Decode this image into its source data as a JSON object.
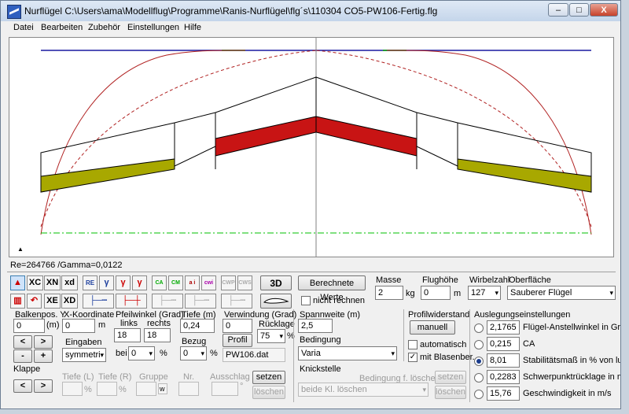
{
  "window": {
    "title": "Nurflügel   C:\\Users\\ama\\Modellflug\\Programme\\Ranis-Nurflügel\\flg´s\\110304 CO5-PW106-Fertig.flg",
    "minimize": "–",
    "maximize": "□",
    "close": "X"
  },
  "menu": [
    "Datei",
    "Bearbeiten",
    "Zubehör",
    "Einstellungen",
    "Hilfe"
  ],
  "colors": {
    "centerline": "#1a1aa0",
    "lift_curve": "#b02020",
    "tip_span": "#b8b800",
    "center_span": "#c81414",
    "ground": "#00c000"
  },
  "status": "Re=264766 /Gamma=0,0122",
  "toolbar": {
    "row1": [
      "RE",
      "γ",
      "γ",
      "γ",
      "CA",
      "CM",
      "a i",
      "cwi",
      "CWP",
      "CWS"
    ],
    "row1_text": [
      "XC",
      "XN",
      "xd"
    ],
    "row2_text": [
      "XE",
      "XD"
    ],
    "btn_3d": "3D",
    "btn_calc": "Berechnete Werte",
    "nicht_rechnen": "nicht rechnen"
  },
  "balkenpos": {
    "label": "Balkenpos. Y",
    "value": "0",
    "unit": "(m)"
  },
  "xkoord": {
    "label": "X-Koordinate",
    "value": "0",
    "unit": "m"
  },
  "eingaben": {
    "label": "Eingaben",
    "value": "symmetri"
  },
  "pfeil": {
    "label": "Pfeilwinkel (Grad)",
    "links": "links",
    "rechts": "rechts",
    "left_value": "18",
    "right_value": "18",
    "bei_label": "bei",
    "bei_value": "0",
    "pct": "%"
  },
  "tiefe": {
    "label": "Tiefe (m)",
    "value": "0,24",
    "bezug_label": "Bezug",
    "bezug_value": "0",
    "pct": "%"
  },
  "verwindung": {
    "label": "Verwindung (Grad)",
    "value": "0",
    "ruecklage_label": "Rücklage",
    "ruecklage_value": "75",
    "pct": "%",
    "profil_btn": "Profil",
    "profil_name": "PW106.dat"
  },
  "spannweite": {
    "label": "Spannweite (m)",
    "value": "2,5",
    "bedingung_label": "Bedingung",
    "bedingung_value": "Varia"
  },
  "masse": {
    "label": "Masse",
    "value": "2",
    "unit": "kg"
  },
  "flughoehe": {
    "label": "Flughöhe",
    "value": "0",
    "unit": "m"
  },
  "wirbelzahl": {
    "label": "Wirbelzahl",
    "value": "127"
  },
  "oberflaeche": {
    "label": "Oberfläche",
    "value": "Sauberer Flügel"
  },
  "profilwiderstand": {
    "label": "Profilwiderstand",
    "btn": "manuell",
    "automatisch": "automatisch",
    "blasen": "mit Blasenber."
  },
  "auslegung": {
    "label": "Auslegungseinstellungen",
    "rows": [
      {
        "value": "2,1765",
        "label": "Flügel-Anstellwinkel in Grad"
      },
      {
        "value": "0,215",
        "label": "CA"
      },
      {
        "value": "8,01",
        "label": "Stabilitätsmaß in % von lu"
      },
      {
        "value": "0,2283",
        "label": "Schwerpunktrücklage in m"
      },
      {
        "value": "15,76",
        "label": "Geschwindigkeit in m/s"
      }
    ]
  },
  "klappe": {
    "label": "Klappe",
    "tiefe_l": "Tiefe (L)",
    "tiefe_r": "Tiefe (R)",
    "gruppe": "Gruppe",
    "nr": "Nr.",
    "ausschlag": "Ausschlag",
    "pct": "%",
    "w": "w",
    "deg": "°",
    "setzen": "setzen",
    "loeschen": "löschen"
  },
  "knick": {
    "label": "Knickstelle",
    "bedingung": "Bedingung f. löschen",
    "select": "beide Kl. löschen",
    "setzen": "setzen",
    "loeschen": "löschen"
  },
  "glyphs": {
    "left": "<",
    "right": ">",
    "minus": "-",
    "plus": "+",
    "arrow": "▾",
    "check": "✓",
    "up": "▲"
  }
}
